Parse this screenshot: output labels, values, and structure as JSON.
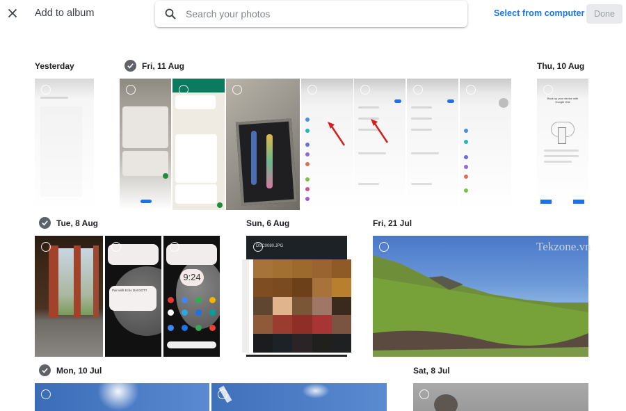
{
  "header": {
    "title": "Add to album",
    "search_placeholder": "Search your photos",
    "search_value": "",
    "select_from_computer": "Select from computer",
    "done_label": "Done"
  },
  "colors": {
    "accent": "#1a73e8",
    "check_bg": "#5f6368",
    "done_bg": "#e8eaed"
  },
  "groups": [
    {
      "label": "Yesterday",
      "has_check": false,
      "photo_count": 1
    },
    {
      "label": "Fri, 11 Aug",
      "has_check": true,
      "photo_count": 7
    },
    {
      "label": "Thu, 10 Aug",
      "has_check": false,
      "photo_count": 1
    },
    {
      "label": "Tue, 8 Aug",
      "has_check": true,
      "photo_count": 3
    },
    {
      "label": "Sun, 6 Aug",
      "has_check": false,
      "photo_count": 1
    },
    {
      "label": "Fri, 21 Jul",
      "has_check": false,
      "photo_count": 1
    },
    {
      "label": "Mon, 10 Jul",
      "has_check": true,
      "photo_count": 2
    },
    {
      "label": "Sat, 8 Jul",
      "has_check": false,
      "photo_count": 1
    }
  ],
  "photo_texts": {
    "clock": "9:24",
    "file_name": "DSC0080.JPG",
    "dialog": "Pair with Echo Dot DOT?",
    "backup": "Back up your device with Google One"
  },
  "watermark": "Tekzone.vn"
}
